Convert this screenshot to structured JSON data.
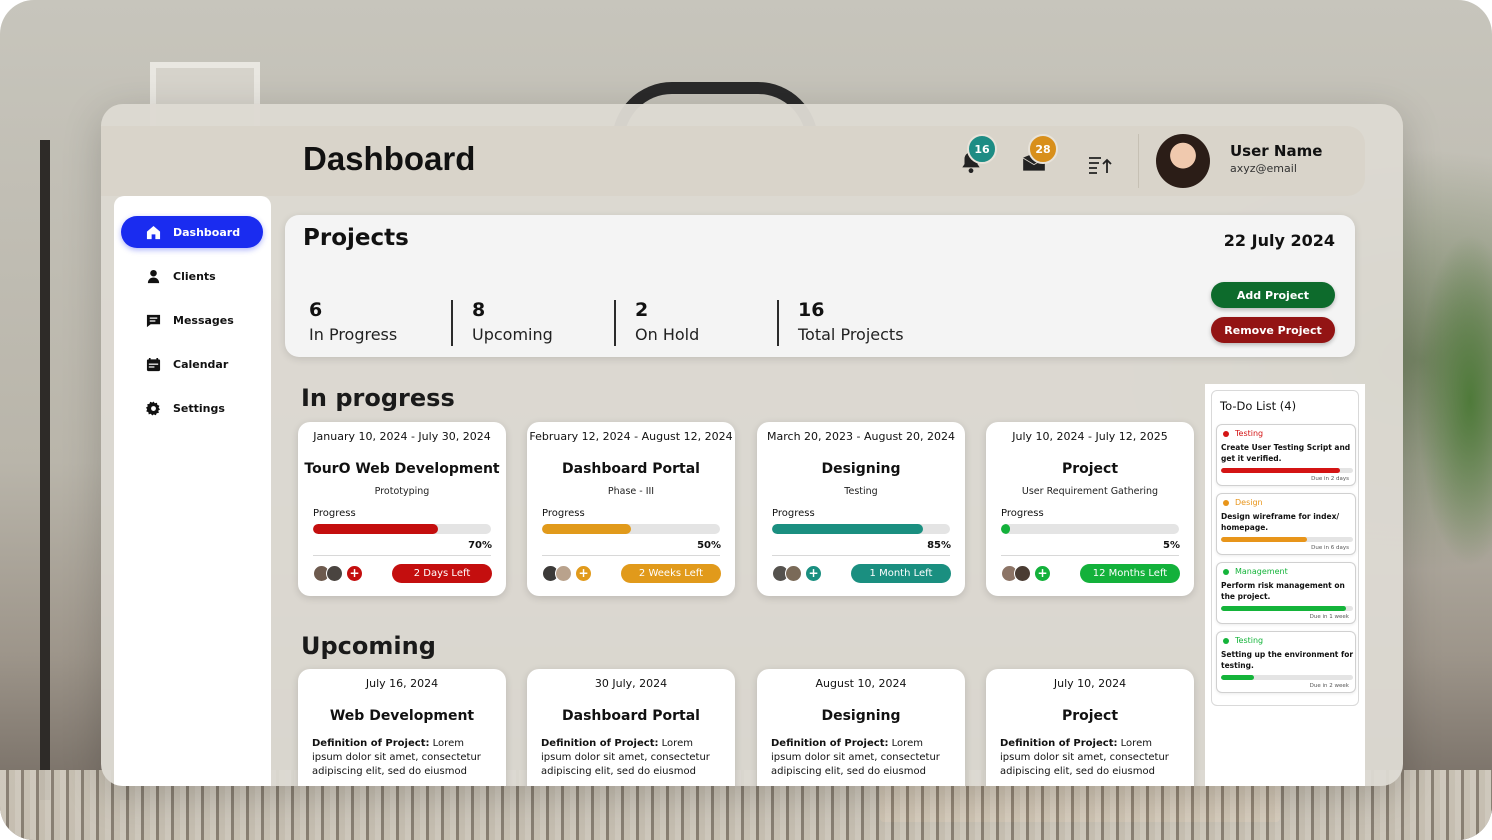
{
  "colors": {
    "accent_blue": "#1a2cf0",
    "green_dark": "#0d6b2c",
    "red_dark": "#931414",
    "red": "#c40e0e",
    "orange": "#e19a1b",
    "teal": "#1a8f80",
    "green": "#13b13b",
    "badge_teal": "#1d8c84",
    "badge_orange": "#d88f1b"
  },
  "header": {
    "title": "Dashboard",
    "notifications": {
      "icon": "bell-icon",
      "count": "16"
    },
    "mail": {
      "icon": "mail-icon",
      "count": "28"
    },
    "sort_icon": "sort-list-icon",
    "user": {
      "name": "User Name",
      "email": "axyz@email"
    }
  },
  "sidebar": {
    "items": [
      {
        "label": "Dashboard",
        "icon": "home-icon",
        "active": true
      },
      {
        "label": "Clients",
        "icon": "user-icon",
        "active": false
      },
      {
        "label": "Messages",
        "icon": "message-icon",
        "active": false
      },
      {
        "label": "Calendar",
        "icon": "calendar-icon",
        "active": false
      },
      {
        "label": "Settings",
        "icon": "gear-icon",
        "active": false
      }
    ]
  },
  "projects": {
    "title": "Projects",
    "date": "22 July 2024",
    "stats": [
      {
        "value": "6",
        "label": "In Progress"
      },
      {
        "value": "8",
        "label": "Upcoming"
      },
      {
        "value": "2",
        "label": "On Hold"
      },
      {
        "value": "16",
        "label": "Total Projects"
      }
    ],
    "add_label": "Add Project",
    "remove_label": "Remove Project"
  },
  "in_progress": {
    "title": "In progress",
    "progress_label": "Progress",
    "cards": [
      {
        "dates": "January 10, 2024 - July 30, 2024",
        "name": "TourO Web Development",
        "phase": "Prototyping",
        "progress": 0.7,
        "percent": "70%",
        "due": "2 Days Left",
        "color": "#c40e0e"
      },
      {
        "dates": "February 12, 2024 - August 12, 2024",
        "name": "Dashboard Portal",
        "phase": "Phase - III",
        "progress": 0.5,
        "percent": "50%",
        "due": "2 Weeks Left",
        "color": "#e19a1b"
      },
      {
        "dates": "March 20, 2023 - August 20, 2024",
        "name": "Designing",
        "phase": "Testing",
        "progress": 0.85,
        "percent": "85%",
        "due": "1 Month Left",
        "color": "#1a8f80"
      },
      {
        "dates": "July 10, 2024 - July 12, 2025",
        "name": "Project",
        "phase": "User Requirement Gathering",
        "progress": 0.05,
        "percent": "5%",
        "due": "12 Months Left",
        "color": "#13b13b"
      }
    ]
  },
  "upcoming": {
    "title": "Upcoming",
    "def_label": "Definition of Project:",
    "cards": [
      {
        "date": "July 16, 2024",
        "name": "Web Development",
        "definition": " Lorem ipsum dolor sit amet, consectetur adipiscing elit, sed do eiusmod"
      },
      {
        "date": "30 July, 2024",
        "name": "Dashboard Portal",
        "definition": " Lorem ipsum dolor sit amet, consectetur adipiscing elit, sed do eiusmod"
      },
      {
        "date": "August 10, 2024",
        "name": "Designing",
        "definition": " Lorem ipsum dolor sit amet, consectetur adipiscing elit, sed do eiusmod"
      },
      {
        "date": "July 10, 2024",
        "name": "Project",
        "definition": " Lorem ipsum dolor sit amet, consectetur adipiscing elit, sed do eiusmod"
      }
    ]
  },
  "todo": {
    "title": "To-Do List (4)",
    "items": [
      {
        "tag": "Testing",
        "desc": "Create User Testing Script and get it verified.",
        "progress": 0.9,
        "due": "Due in 2 days",
        "color": "#d41414"
      },
      {
        "tag": "Design",
        "desc": "Design wireframe for index/ homepage.",
        "progress": 0.65,
        "due": "Due in 6 days",
        "color": "#e8951a"
      },
      {
        "tag": "Management",
        "desc": "Perform risk management on the project.",
        "progress": 0.95,
        "due": "Due in 1 week",
        "color": "#14b43a"
      },
      {
        "tag": "Testing",
        "desc": "Setting up the environment for testing.",
        "progress": 0.25,
        "due": "Due in 2 week",
        "color": "#14b43a"
      }
    ]
  }
}
